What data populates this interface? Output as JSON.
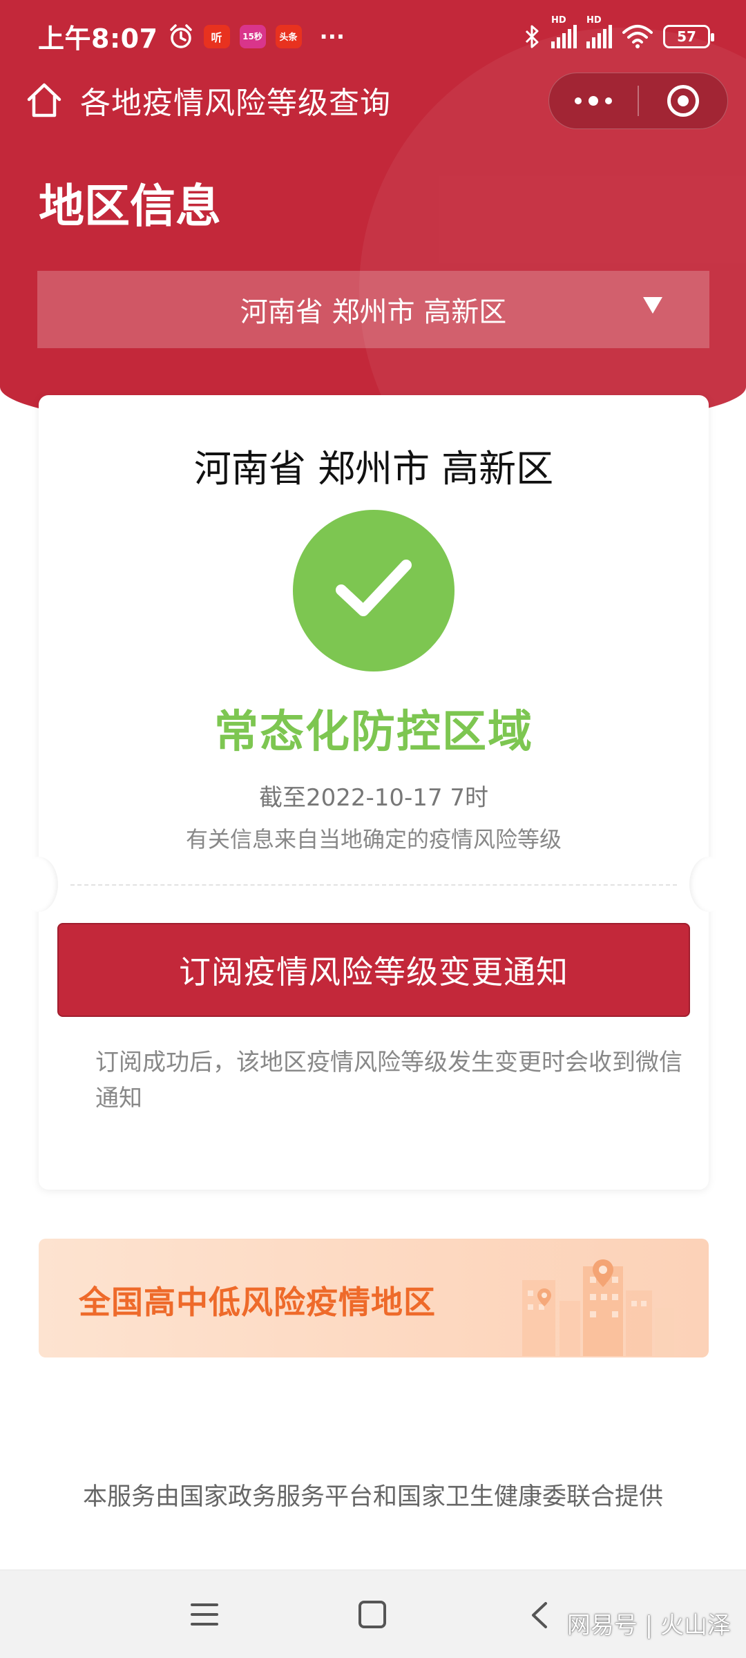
{
  "status_bar": {
    "time": "上午8:07",
    "app_badges": [
      "听",
      "15秒",
      "头条"
    ],
    "more": "···",
    "battery": "57",
    "hd_labels": [
      "HD",
      "HD"
    ]
  },
  "nav": {
    "title": "各地疫情风险等级查询"
  },
  "section": {
    "title": "地区信息"
  },
  "region_selector": {
    "value": "河南省 郑州市 高新区"
  },
  "card": {
    "region": "河南省 郑州市 高新区",
    "risk_level": "常态化防控区域",
    "as_of": "截至2022-10-17 7时",
    "source_note": "有关信息来自当地确定的疫情风险等级",
    "subscribe_button": "订阅疫情风险等级变更通知",
    "subscribe_note": "订阅成功后，该地区疫情风险等级发生变更时会收到微信通知"
  },
  "banner": {
    "label": "全国高中低风险疫情地区"
  },
  "footer": {
    "text": "本服务由国家政务服务平台和国家卫生健康委联合提供"
  },
  "watermark": "网易号 | 火山泽",
  "colors": {
    "brand_red": "#c3283a",
    "safe_green": "#7dc651",
    "banner_orange": "#ee6a2a"
  },
  "icons": [
    "alarm-icon",
    "bluetooth-icon",
    "signal-icon",
    "wifi-icon",
    "battery-icon",
    "home-icon",
    "more-icon",
    "close-target-icon",
    "check-icon",
    "dropdown-arrow-icon",
    "buildings-illustration",
    "nav-menu-icon",
    "nav-home-icon",
    "nav-back-icon"
  ]
}
